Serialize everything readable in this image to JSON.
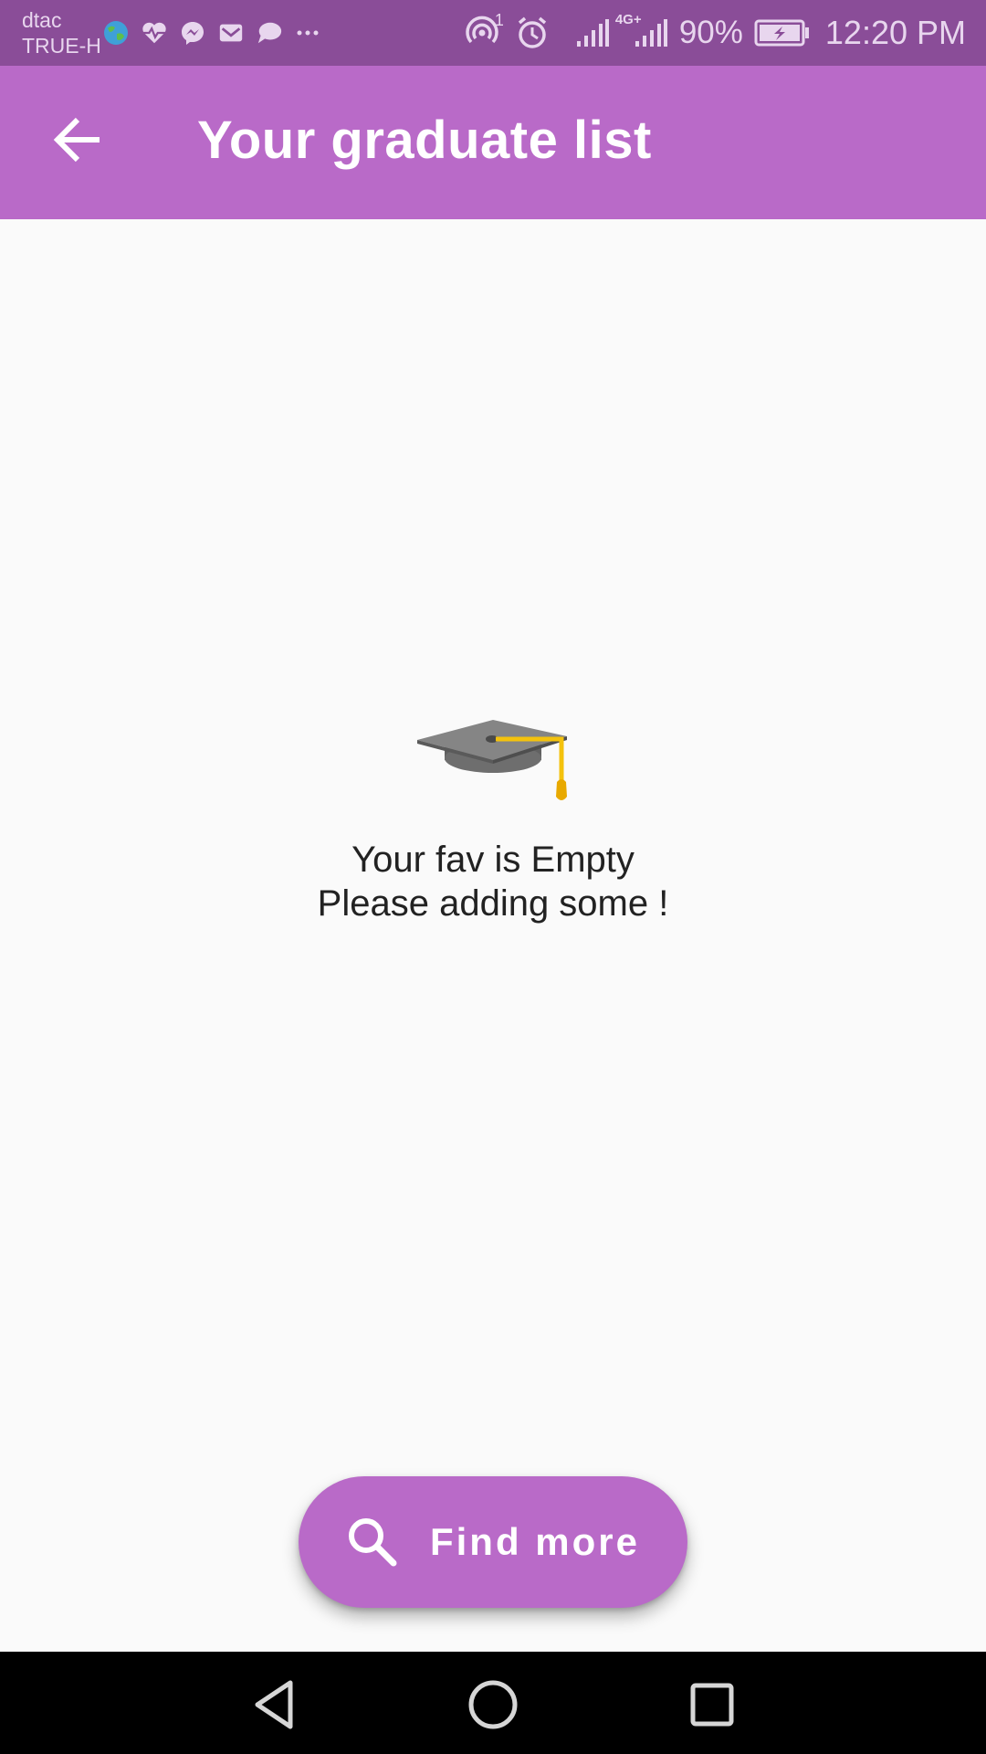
{
  "status_bar": {
    "carrier_primary": "dtac",
    "carrier_secondary": "TRUE-H",
    "notification_icons": [
      "globe-icon",
      "heart-rate-icon",
      "messenger-icon",
      "mail-icon",
      "chat-bubble-icon",
      "more-dots-icon"
    ],
    "hotspot_badge": "1",
    "network_type": "4G+",
    "battery_percent": "90%",
    "time": "12:20 PM"
  },
  "app_bar": {
    "title": "Your graduate list",
    "back_icon": "arrow-back-icon"
  },
  "empty_state": {
    "icon": "graduation-cap-icon",
    "line1": "Your fav is Empty",
    "line2": "Please adding some !"
  },
  "fab": {
    "icon": "search-icon",
    "label": "Find more"
  },
  "nav_bar": {
    "buttons": [
      "back-triangle-icon",
      "home-circle-icon",
      "recents-square-icon"
    ]
  },
  "colors": {
    "status_bar": "#8a4d98",
    "app_bar": "#b96ac8",
    "fab": "#b96ac8",
    "background": "#fafafa",
    "nav_bar": "#000000"
  }
}
